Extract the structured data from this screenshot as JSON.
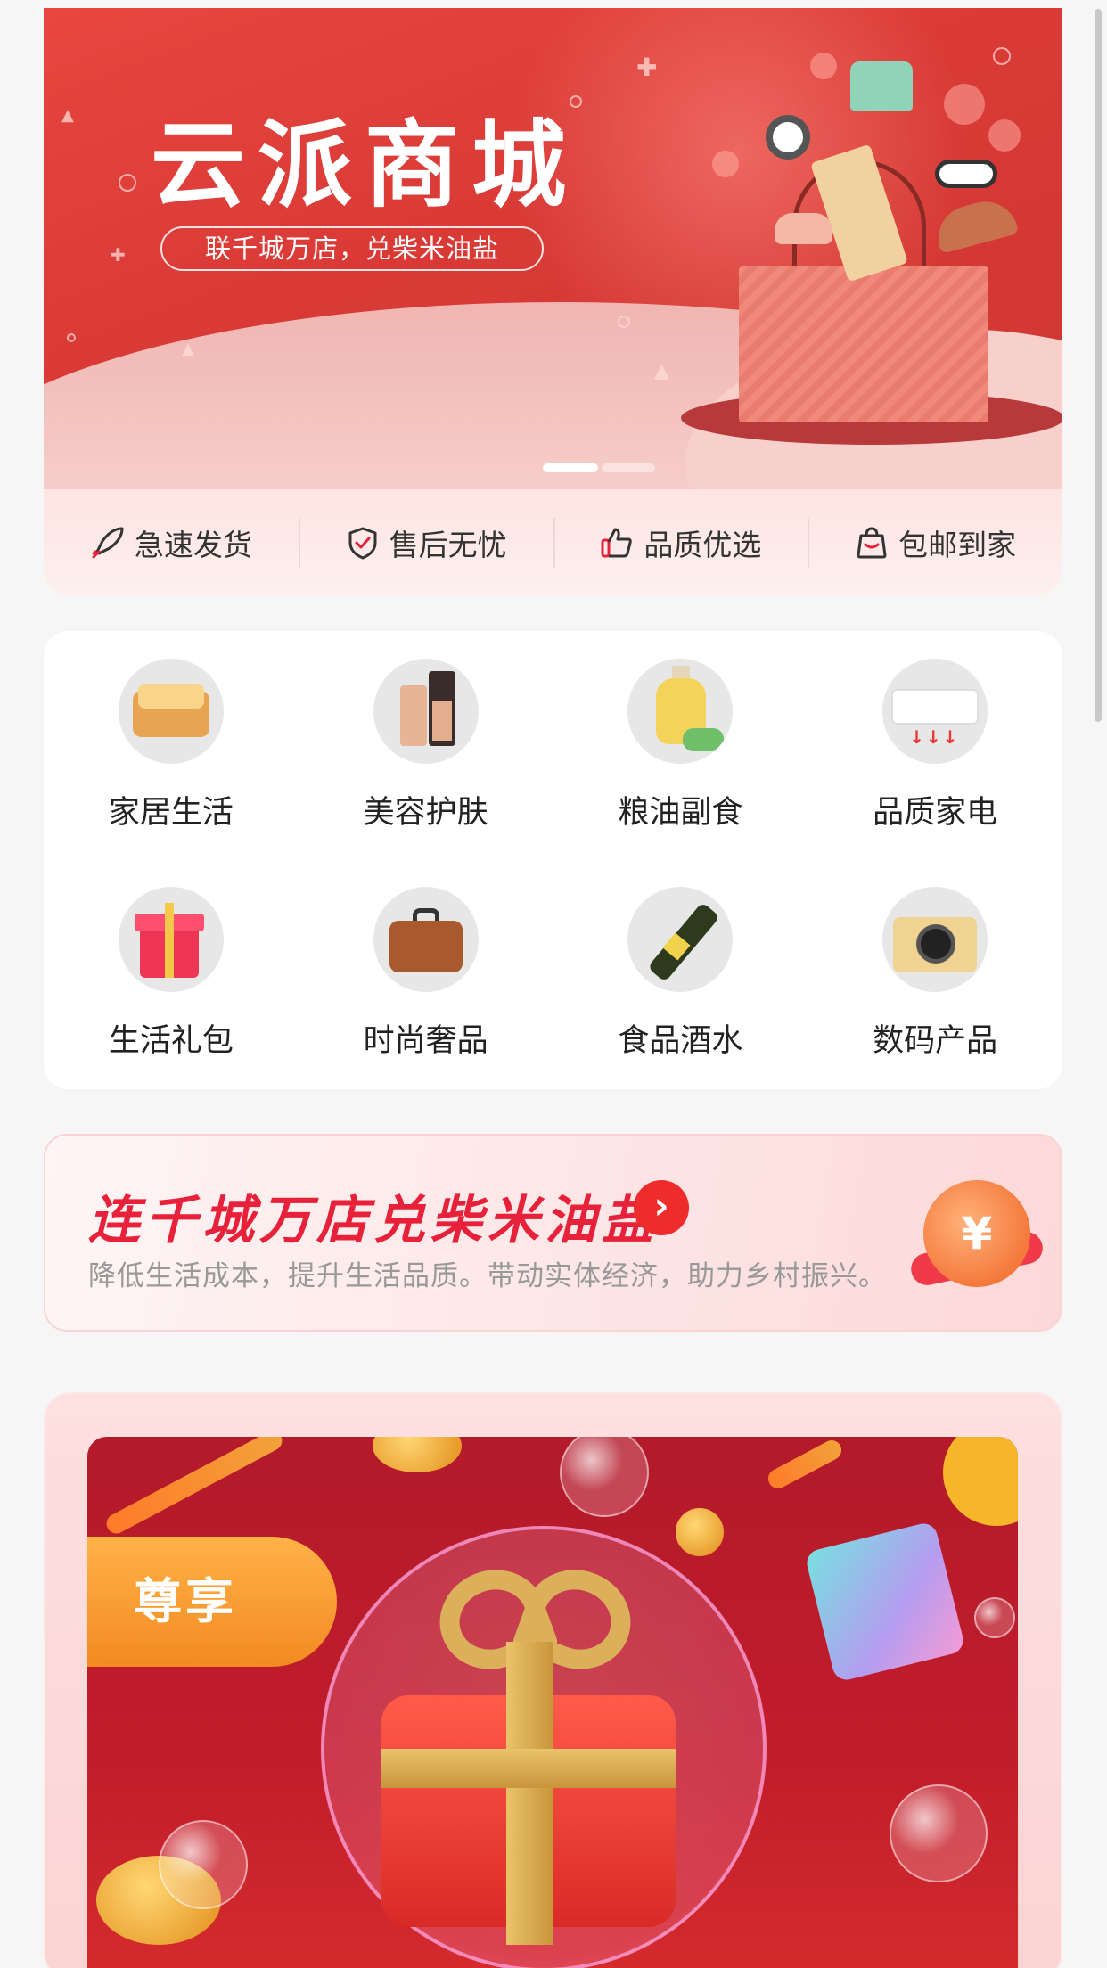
{
  "banner": {
    "title": "云派商城",
    "subtitle": "联千城万店，兑柴米油盐",
    "carousel": {
      "current": 1,
      "total": 2
    }
  },
  "features": [
    {
      "label": "急速发货",
      "icon": "rocket-icon"
    },
    {
      "label": "售后无忧",
      "icon": "shield-check-icon"
    },
    {
      "label": "品质优选",
      "icon": "thumbs-up-icon"
    },
    {
      "label": "包邮到家",
      "icon": "bag-icon"
    }
  ],
  "categories": [
    {
      "label": "家居生活",
      "icon": "bed-icon"
    },
    {
      "label": "美容护肤",
      "icon": "cosmetics-icon"
    },
    {
      "label": "粮油副食",
      "icon": "oil-bottle-icon"
    },
    {
      "label": "品质家电",
      "icon": "air-conditioner-icon"
    },
    {
      "label": "生活礼包",
      "icon": "gift-icon"
    },
    {
      "label": "时尚奢品",
      "icon": "briefcase-icon"
    },
    {
      "label": "食品酒水",
      "icon": "wine-bottle-icon"
    },
    {
      "label": "数码产品",
      "icon": "camera-icon"
    }
  ],
  "promo": {
    "title": "连千城万店兑柴米油盐",
    "description": "降低生活成本，提升生活品质。带动实体经济，助力乡村振兴。",
    "coin_symbol": "¥"
  },
  "exclusive": {
    "tag": "尊享"
  },
  "colors": {
    "brand_red": "#d93a36",
    "promo_red": "#e8213a",
    "tag_orange": "#f38a22"
  }
}
